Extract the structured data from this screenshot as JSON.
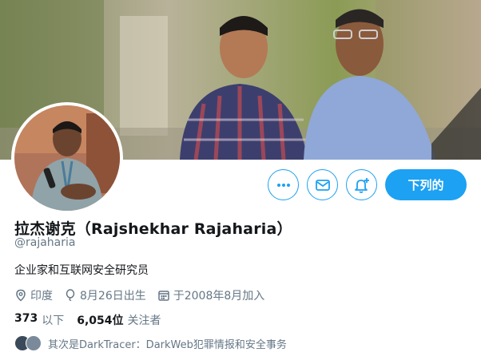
{
  "profile": {
    "name": "拉杰谢克（Rajshekhar Rajaharia）",
    "handle": "@rajaharia",
    "bio": "企业家和互联网安全研究员",
    "location": "印度",
    "birthday": "8月26日出生",
    "joined": "于2008年8月加入"
  },
  "stats": {
    "following_count": "373",
    "following_label": "以下",
    "followers_count": "6,054位",
    "followers_label": "关注者"
  },
  "followed_by": "其次是DarkTracer：DarkWeb犯罪情报和安全事务",
  "actions": {
    "follow_label": "下列的",
    "more_icon": "more-icon",
    "message_icon": "envelope-icon",
    "notify_icon": "bell-plus-icon"
  },
  "colors": {
    "accent": "#1da1f2",
    "secondary_text": "#657786"
  }
}
